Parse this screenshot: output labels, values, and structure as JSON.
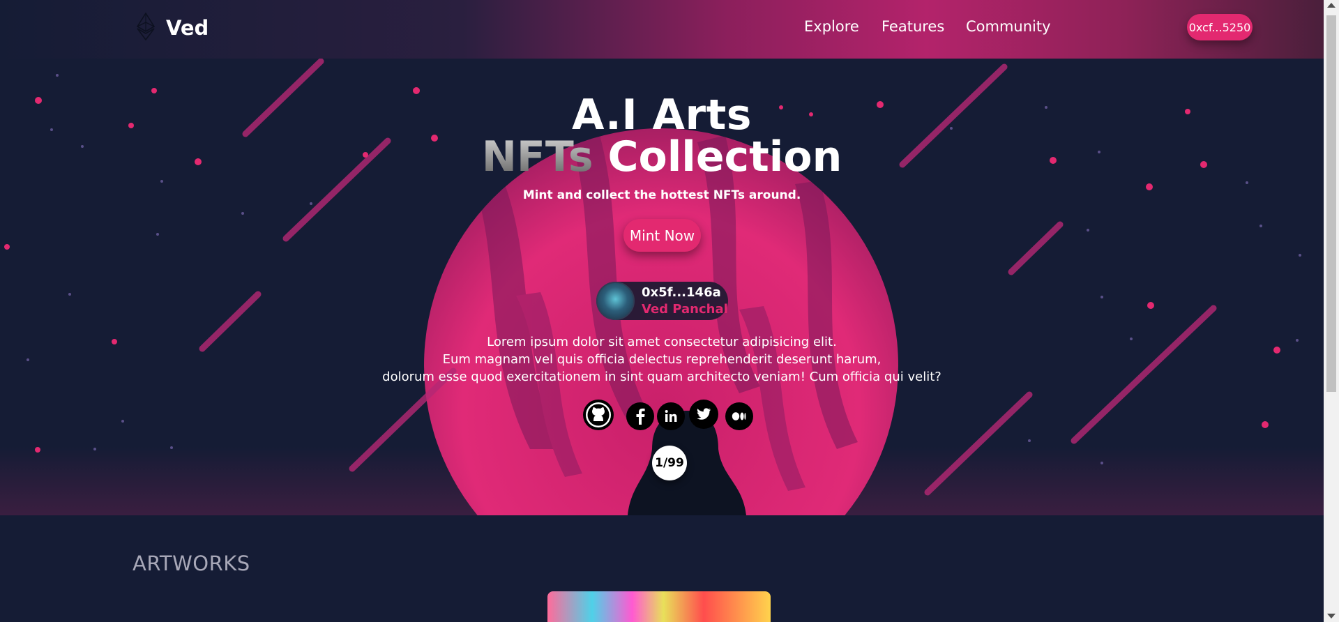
{
  "header": {
    "logo_text": "Ved",
    "logo_icon": "ethereum-icon",
    "nav": [
      "Explore",
      "Features",
      "Community"
    ],
    "wallet_address": "0xcf...5250"
  },
  "hero": {
    "title_line1": "A.I Arts",
    "title_line2_accent": "NFTs",
    "title_line2_rest": "Collection",
    "subtitle": "Mint and collect the hottest NFTs around.",
    "mint_button": "Mint Now",
    "owner": {
      "address": "0x5f...146a",
      "name": "Ved Panchal"
    },
    "description": [
      "Lorem ipsum dolor sit amet consectetur adipisicing elit.",
      "Eum magnam vel quis officia delectus reprehenderit deserunt harum,",
      "dolorum esse quod exercitationem in sint quam architecto veniam! Cum officia qui velit?"
    ],
    "social_icons": [
      "github-icon",
      "facebook-icon",
      "linkedin-icon",
      "twitter-icon",
      "medium-icon"
    ],
    "counter": "1/99"
  },
  "artworks": {
    "heading": "ARTWORKS"
  },
  "colors": {
    "accent": "#e32970",
    "background": "#151c35"
  }
}
